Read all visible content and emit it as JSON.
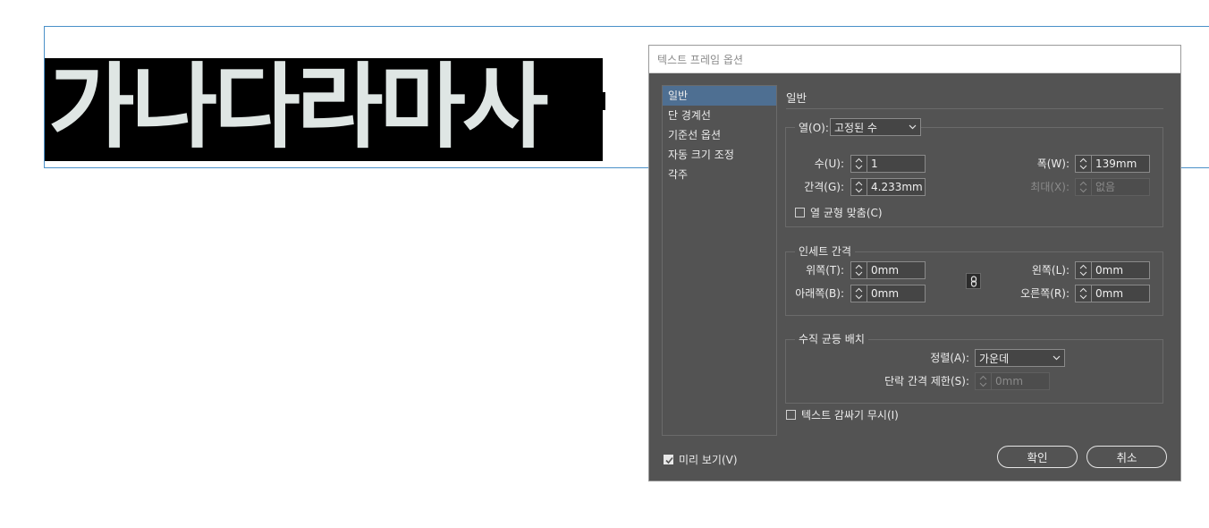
{
  "document": {
    "headline": "가나다라마사"
  },
  "dialog": {
    "title": "텍스트 프레임 옵션",
    "nav": [
      {
        "label": "일반",
        "selected": true
      },
      {
        "label": "단 경계선",
        "selected": false
      },
      {
        "label": "기준선 옵션",
        "selected": false
      },
      {
        "label": "자동 크기 조정",
        "selected": false
      },
      {
        "label": "각주",
        "selected": false
      }
    ],
    "section_title": "일반",
    "columns": {
      "label": "열(O):",
      "mode": "고정된 수",
      "number_label": "수(U):",
      "number_value": "1",
      "gutter_label": "간격(G):",
      "gutter_value": "4.233mm",
      "width_label": "폭(W):",
      "width_value": "139mm",
      "max_label": "최대(X):",
      "max_value": "없음",
      "balance_label": "열 균형 맞춤(C)"
    },
    "inset": {
      "title": "인세트 간격",
      "top_label": "위쪽(T):",
      "top_value": "0mm",
      "bottom_label": "아래쪽(B):",
      "bottom_value": "0mm",
      "left_label": "왼쪽(L):",
      "left_value": "0mm",
      "right_label": "오른쪽(R):",
      "right_value": "0mm"
    },
    "vertical_justification": {
      "title": "수직 균등 배치",
      "align_label": "정렬(A):",
      "align_value": "가운데",
      "limit_label": "단락 간격 제한(S):",
      "limit_value": "0mm"
    },
    "ignore_wrap_label": "텍스트 감싸기 무시(I)",
    "preview_label": "미리 보기(V)",
    "preview_checked": true,
    "ok_label": "확인",
    "cancel_label": "취소"
  },
  "colors": {
    "dialog_bg": "#535353",
    "selection": "#4e6f92",
    "frame_guide": "#4a90c8",
    "headline_bg": "#000000",
    "headline_fg": "#dfe6e4"
  }
}
